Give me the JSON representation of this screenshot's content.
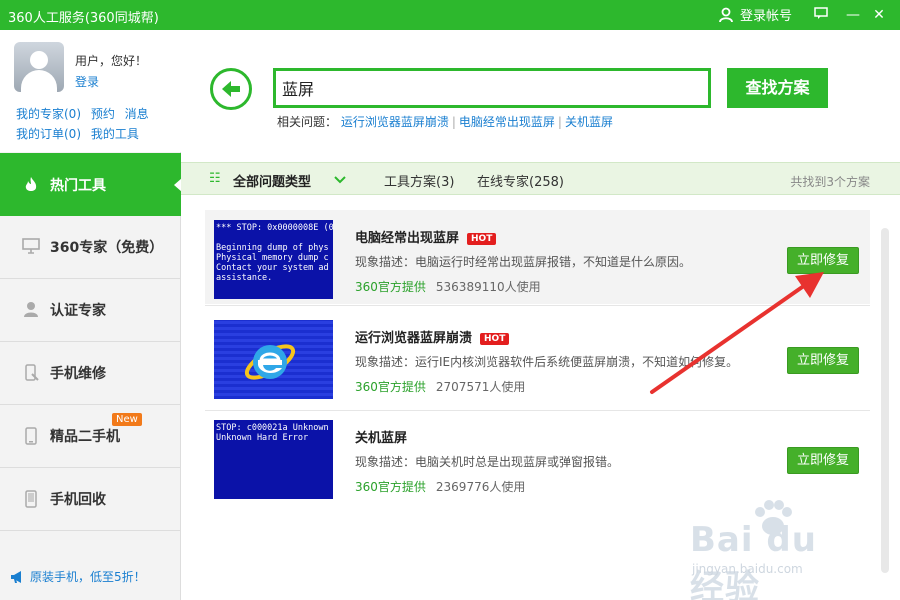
{
  "titlebar": {
    "title": "360人工服务(360同城帮)",
    "login_label": "登录帐号",
    "controls": [
      "message-icon",
      "minimize-icon",
      "close-icon"
    ]
  },
  "user": {
    "greeting": "用户，您好！",
    "login_link": "登录",
    "links_row1": [
      "我的专家(0)",
      "预约",
      "消息"
    ],
    "links_row2": [
      "我的订单(0)",
      "我的工具"
    ]
  },
  "sidebar": {
    "items": [
      {
        "label": "热门工具",
        "icon": "fire-icon",
        "active": true
      },
      {
        "label": "360专家（免费）",
        "icon": "monitor-icon",
        "active": false
      },
      {
        "label": "认证专家",
        "icon": "person-icon",
        "active": false
      },
      {
        "label": "手机维修",
        "icon": "repair-icon",
        "active": false
      },
      {
        "label": "精品二手机",
        "icon": "phone-icon",
        "active": false,
        "badge": "New"
      },
      {
        "label": "手机回收",
        "icon": "recycle-icon",
        "active": false
      }
    ],
    "promo": "原装手机，低至5折！"
  },
  "search": {
    "value": "蓝屏",
    "button_label": "查找方案",
    "related_label": "相关问题：",
    "related_links": [
      "运行浏览器蓝屏崩溃",
      "电脑经常出现蓝屏",
      "关机蓝屏"
    ]
  },
  "filter": {
    "all_types": "全部问题类型",
    "tabs": [
      "工具方案(3)",
      "在线专家(258)"
    ],
    "result_count": "共找到3个方案"
  },
  "results": [
    {
      "title": "电脑经常出现蓝屏",
      "hot": "HOT",
      "desc": "现象描述：电脑运行时经常出现蓝屏报错，不知道是什么原因。",
      "provider": "360官方提供",
      "users": "536389110人使用",
      "fix_label": "立即修复",
      "thumb_text": "*** STOP: 0x0000008E (0\n\nBeginning dump of phys\nPhysical memory dump c\nContact your system ad\nassistance."
    },
    {
      "title": "运行浏览器蓝屏崩溃",
      "hot": "HOT",
      "desc": "现象描述：运行IE内核浏览器软件后系统便蓝屏崩溃，不知道如何修复。",
      "provider": "360官方提供",
      "users": "2707571人使用",
      "fix_label": "立即修复",
      "thumb_text": ""
    },
    {
      "title": "关机蓝屏",
      "hot": "",
      "desc": "现象描述：电脑关机时总是出现蓝屏或弹窗报错。",
      "provider": "360官方提供",
      "users": "2369776人使用",
      "fix_label": "立即修复",
      "thumb_text": "STOP: c000021a Unknown\nUnknown Hard Error"
    }
  ],
  "watermark": {
    "main": "Bai du 经验",
    "sub": "jingyan.baidu.com"
  },
  "colors": {
    "brand_green": "#2db82d",
    "link_blue": "#1a7fd0",
    "hot_red": "#e31e1e",
    "bsod_blue": "#0b12a8",
    "annotation_red": "#e8322f"
  }
}
